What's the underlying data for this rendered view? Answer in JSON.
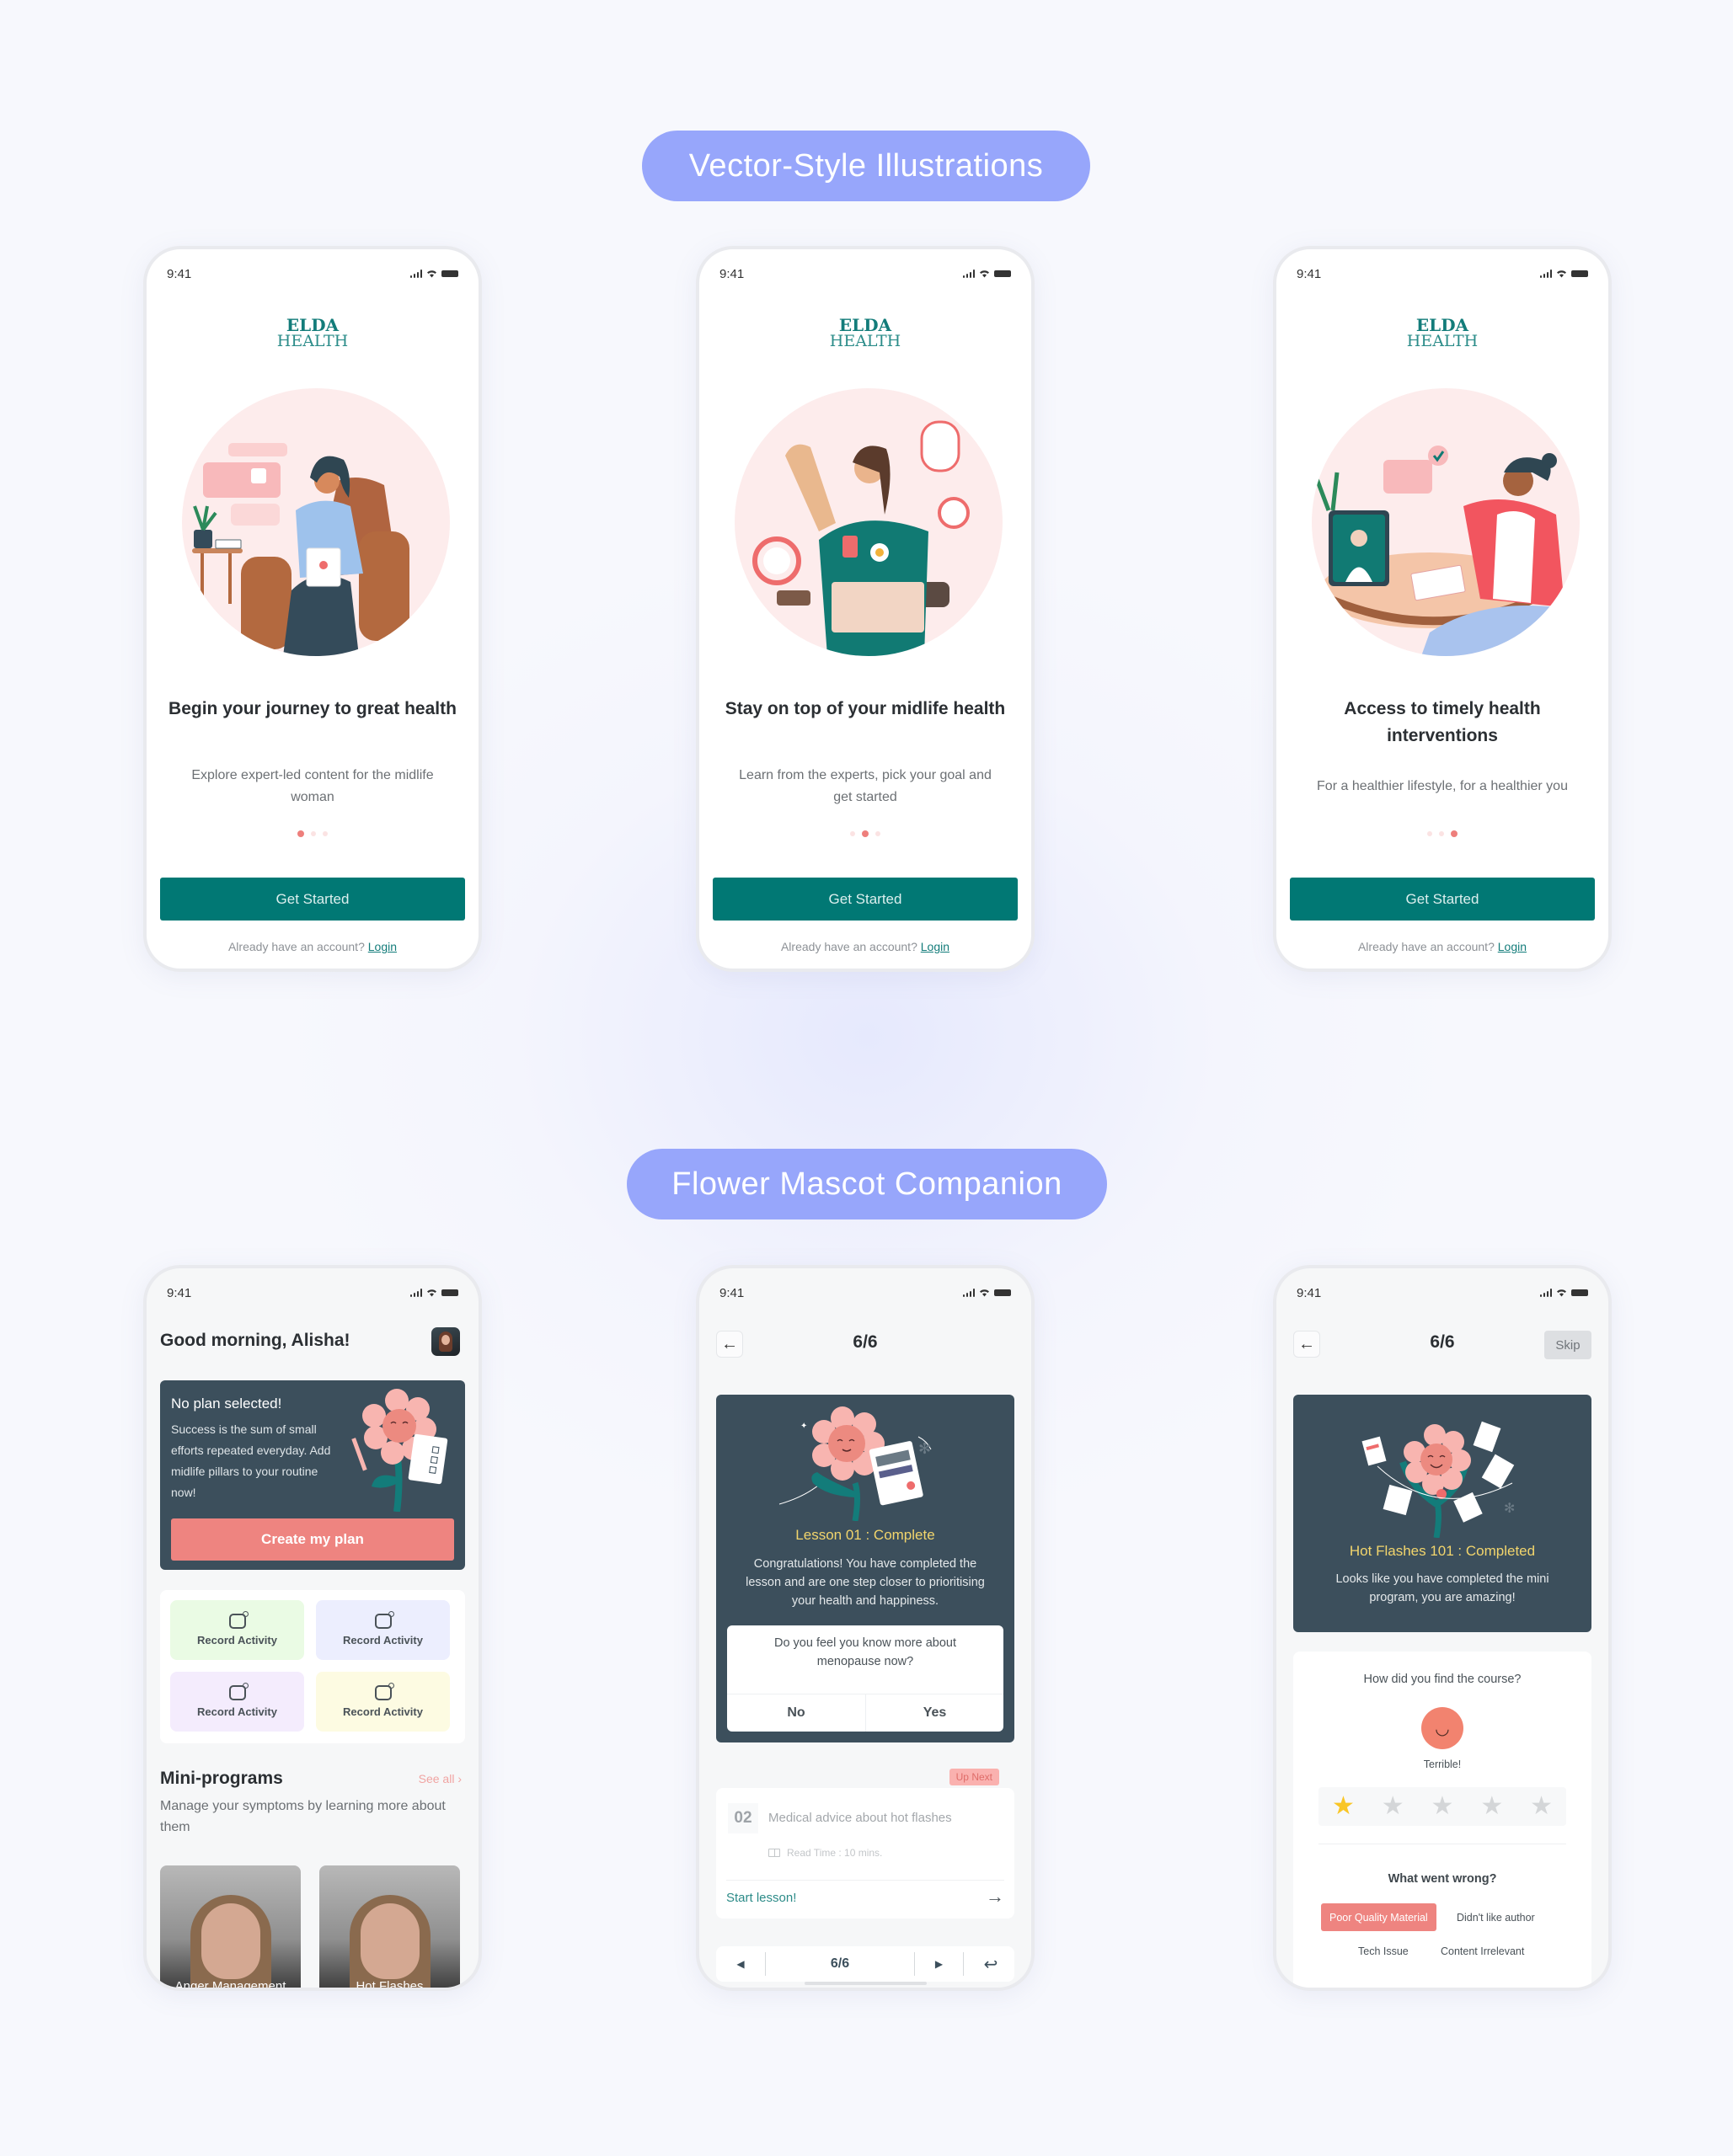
{
  "sections": [
    {
      "label": "Vector-Style Illustrations"
    },
    {
      "label": "Flower Mascot Companion"
    }
  ],
  "status": {
    "time": "9:41"
  },
  "brand": {
    "line1": "ELDA",
    "line2": "HEALTH"
  },
  "onboarding": [
    {
      "title": "Begin your journey to great health",
      "subtitle": "Explore expert-led content for the midlife woman",
      "active_dot": 1,
      "total_dots": 3,
      "cta": "Get Started",
      "account_prompt": "Already have an account?",
      "login": "Login",
      "illustration": "woman-on-armchair-with-tablet"
    },
    {
      "title": "Stay on top of your midlife health",
      "subtitle": "Learn from the experts, pick your goal and get started",
      "active_dot": 2,
      "total_dots": 3,
      "cta": "Get Started",
      "account_prompt": "Already have an account?",
      "login": "Login",
      "illustration": "woman-exercising-with-checklist"
    },
    {
      "title": "Access to timely health interventions",
      "subtitle": "For a healthier lifestyle, for a healthier you",
      "active_dot": 3,
      "total_dots": 3,
      "cta": "Get Started",
      "account_prompt": "Already have an account?",
      "login": "Login",
      "illustration": "woman-video-call-with-doctor"
    }
  ],
  "home": {
    "greeting": "Good morning, Alisha!",
    "plan_card": {
      "title": "No plan selected!",
      "description": "Success is the sum of small efforts repeated everyday. Add midlife pillars to your routine now!",
      "button": "Create my plan"
    },
    "activities": [
      {
        "label": "Record Activity",
        "color": "#eafbe4"
      },
      {
        "label": "Record Activity",
        "color": "#eceefe"
      },
      {
        "label": "Record Activity",
        "color": "#f4ecfd"
      },
      {
        "label": "Record Activity",
        "color": "#fdfbe2"
      }
    ],
    "mini_programs": {
      "title": "Mini-programs",
      "see_all": "See all",
      "subtitle": "Manage your symptoms by learning more about them",
      "items": [
        {
          "label": "Anger Management"
        },
        {
          "label": "Hot Flashes"
        }
      ]
    }
  },
  "lesson": {
    "progress": "6/6",
    "card": {
      "title": "Lesson 01 : Complete",
      "text": "Congratulations! You have completed the lesson and are one step closer to prioritising your health and happiness."
    },
    "question": {
      "text": "Do you feel you know more about menopause now?",
      "no": "No",
      "yes": "Yes"
    },
    "up_next": {
      "badge": "Up Next",
      "number": "02",
      "title": "Medical advice about hot flashes",
      "read_time": "Read Time : 10 mins.",
      "cta": "Start lesson!"
    },
    "pager": {
      "page": "6/6"
    }
  },
  "feedback": {
    "progress": "6/6",
    "skip": "Skip",
    "card": {
      "title": "Hot Flashes 101 : Completed",
      "text": "Looks like you have completed the mini program, you are amazing!"
    },
    "question": "How did you find the course?",
    "emoji_label": "Terrible!",
    "rating": 1,
    "rating_max": 5,
    "what_wrong": "What went wrong?",
    "chips": [
      {
        "label": "Poor Quality Material",
        "selected": true
      },
      {
        "label": "Didn't like author",
        "selected": false
      },
      {
        "label": "Tech Issue",
        "selected": false
      },
      {
        "label": "Content Irrelevant",
        "selected": false
      }
    ]
  },
  "colors": {
    "pill": "#97a6fb",
    "teal": "#017874",
    "coral": "#ee8480",
    "dark_card": "#3c4f5c",
    "gold": "#f2d56c",
    "star": "#f9c627"
  }
}
